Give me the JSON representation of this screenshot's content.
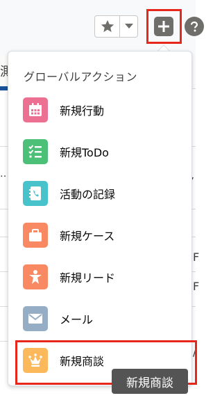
{
  "header": {
    "favorites_icon": "star-icon",
    "favorites_menu_icon": "chevron-down-icon",
    "global_actions_icon": "plus-icon",
    "help_icon": "help-icon"
  },
  "background": {
    "fragment_left": "測",
    "fragment_dots": "…",
    "fragment_right_1": "F",
    "fragment_right_2": "F",
    "fragment_right_3": "/",
    "fragment_chevron": "▾"
  },
  "dropdown": {
    "header": "グローバルアクション",
    "items": [
      {
        "label": "新規行動",
        "icon": "calendar-icon",
        "color": "#eb7092"
      },
      {
        "label": "新規ToDo",
        "icon": "task-list-icon",
        "color": "#4bc076"
      },
      {
        "label": "活動の記録",
        "icon": "log-call-icon",
        "color": "#48c3cc"
      },
      {
        "label": "新規ケース",
        "icon": "briefcase-icon",
        "color": "#f2cf5b"
      },
      {
        "label": "新規リード",
        "icon": "lead-person-icon",
        "color": "#f88962"
      },
      {
        "label": "メール",
        "icon": "email-icon",
        "color": "#95aec5"
      },
      {
        "label": "新規商談",
        "icon": "crown-icon",
        "color": "#fcb95b"
      }
    ]
  },
  "tooltip": {
    "text": "新規商談"
  },
  "colors": {
    "highlight": "#e8271c",
    "icon_gray": "#706e6b"
  }
}
